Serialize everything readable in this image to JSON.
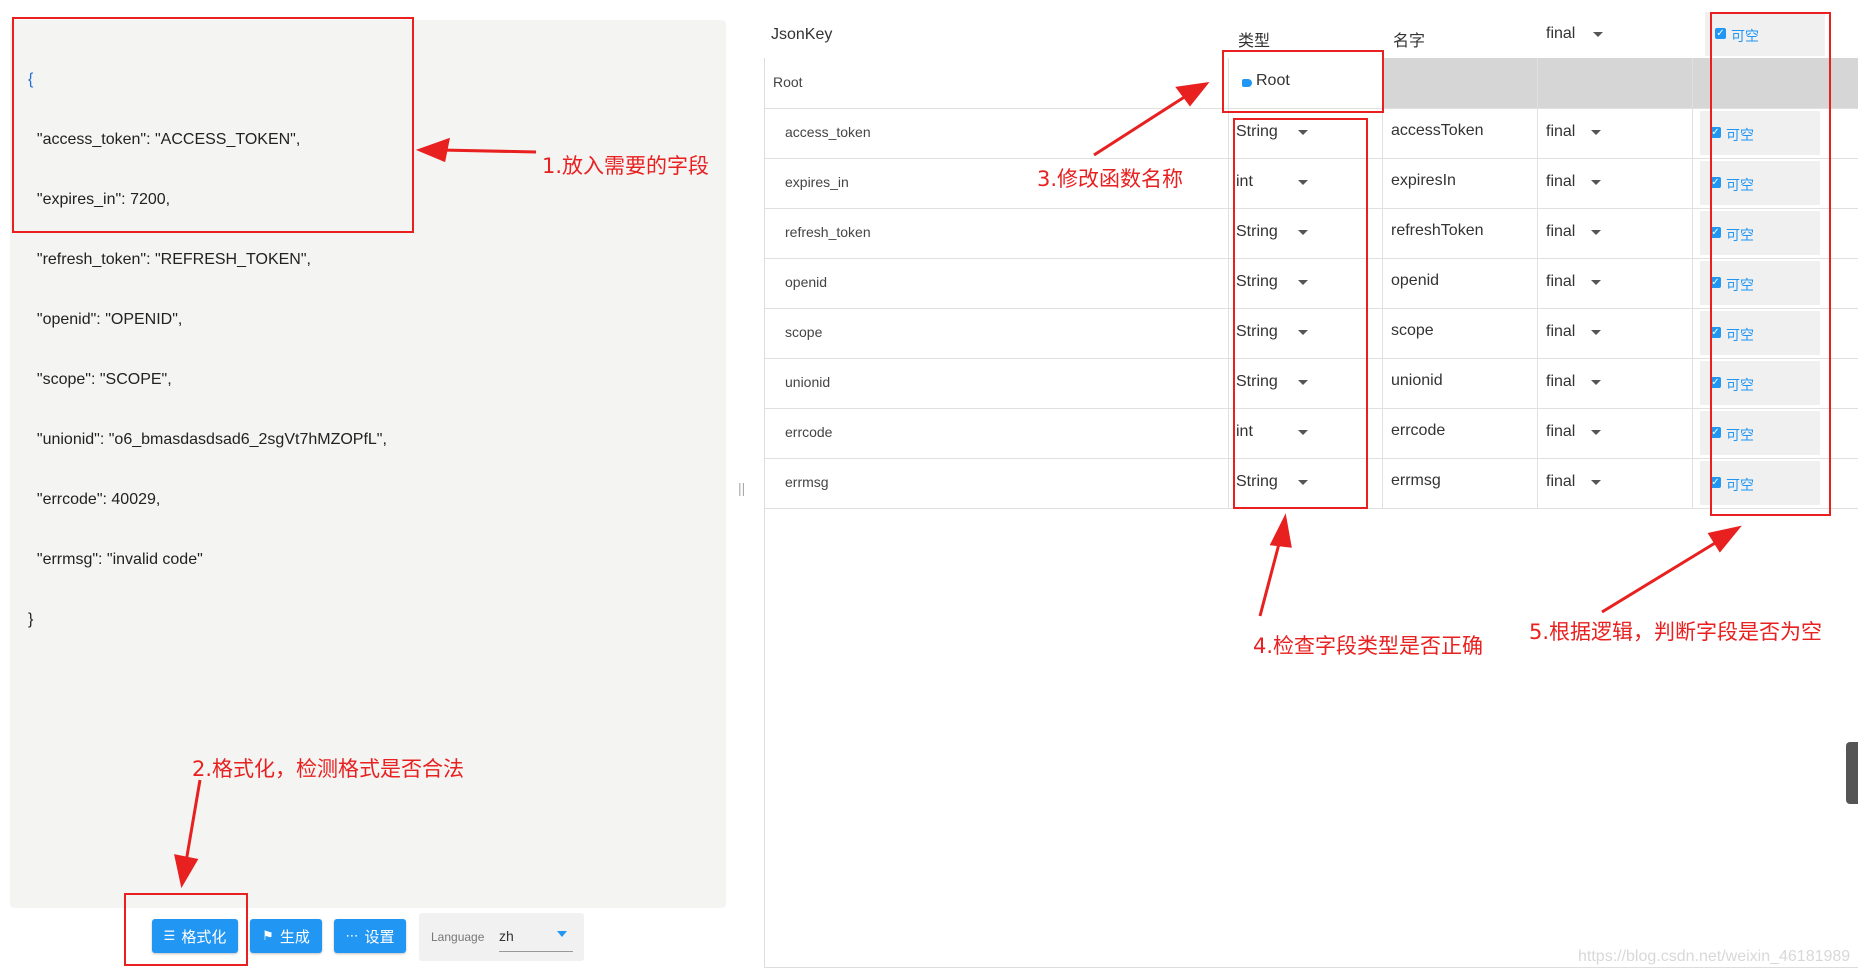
{
  "editor": {
    "open_brace": "{",
    "lines": [
      "  \"access_token\": \"ACCESS_TOKEN\",",
      "  \"expires_in\": 7200,",
      "  \"refresh_token\": \"REFRESH_TOKEN\",",
      "  \"openid\": \"OPENID\",",
      "  \"scope\": \"SCOPE\",",
      "  \"unionid\": \"o6_bmasdasdsad6_2sgVt7hMZOPfL\",",
      "  \"errcode\": 40029,",
      "  \"errmsg\": \"invalid code\""
    ],
    "close_brace": "}"
  },
  "toolbar": {
    "format_label": "格式化",
    "generate_label": "生成",
    "settings_label": "设置",
    "language_label": "Language",
    "language_value": "zh"
  },
  "table": {
    "headers": {
      "key": "JsonKey",
      "type": "类型",
      "name": "名字",
      "final": "final",
      "nullable": "可空"
    },
    "root": {
      "key": "Root",
      "name": "Root"
    },
    "rows": [
      {
        "key": "access_token",
        "type": "String",
        "name": "accessToken",
        "final": "final",
        "nullable": "可空"
      },
      {
        "key": "expires_in",
        "type": "int",
        "name": "expiresIn",
        "final": "final",
        "nullable": "可空"
      },
      {
        "key": "refresh_token",
        "type": "String",
        "name": "refreshToken",
        "final": "final",
        "nullable": "可空"
      },
      {
        "key": "openid",
        "type": "String",
        "name": "openid",
        "final": "final",
        "nullable": "可空"
      },
      {
        "key": "scope",
        "type": "String",
        "name": "scope",
        "final": "final",
        "nullable": "可空"
      },
      {
        "key": "unionid",
        "type": "String",
        "name": "unionid",
        "final": "final",
        "nullable": "可空"
      },
      {
        "key": "errcode",
        "type": "int",
        "name": "errcode",
        "final": "final",
        "nullable": "可空"
      },
      {
        "key": "errmsg",
        "type": "String",
        "name": "errmsg",
        "final": "final",
        "nullable": "可空"
      }
    ]
  },
  "annotations": {
    "step1": "1.放入需要的字段",
    "step2": "2.格式化，检测格式是否合法",
    "step3": "3.修改函数名称",
    "step4": "4.检查字段类型是否正确",
    "step5": "5.根据逻辑，判断字段是否为空"
  },
  "watermark": "https://blog.csdn.net/weixin_46181989",
  "colors": {
    "accent": "#2196f3",
    "annotation": "#e82020",
    "editor_bg": "#f4f4f2"
  }
}
